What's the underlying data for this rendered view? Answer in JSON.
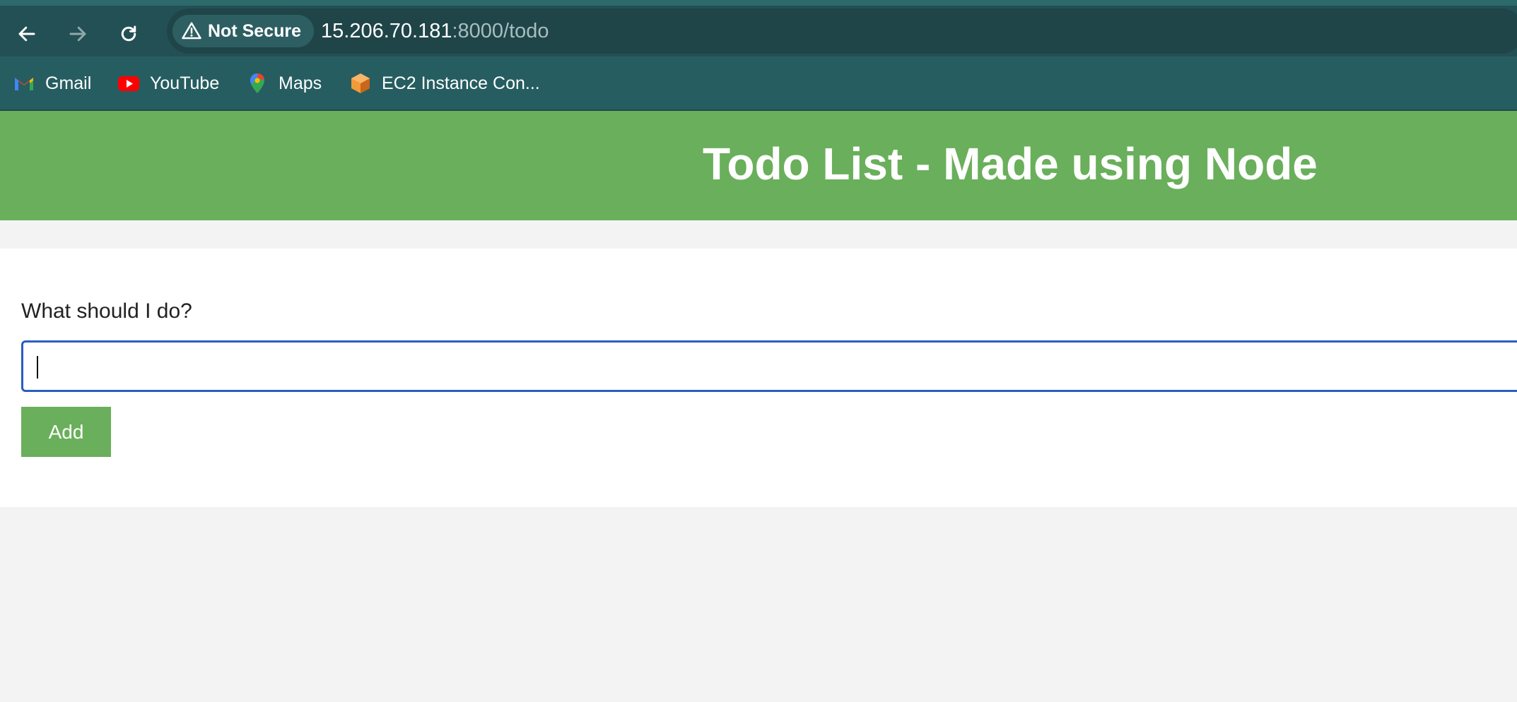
{
  "browser": {
    "security_label": "Not Secure",
    "url_host": "15.206.70.181",
    "url_path": ":8000/todo",
    "icons": {
      "back": "arrow-left-icon",
      "forward": "arrow-right-icon",
      "reload": "reload-icon",
      "security": "warning-triangle-icon"
    }
  },
  "bookmarks": [
    {
      "label": "Gmail",
      "icon": "gmail-icon"
    },
    {
      "label": "YouTube",
      "icon": "youtube-icon"
    },
    {
      "label": "Maps",
      "icon": "maps-icon"
    },
    {
      "label": "EC2 Instance Con...",
      "icon": "ec2-icon"
    }
  ],
  "page": {
    "title": "Todo List - Made using Node",
    "form": {
      "label": "What should I do?",
      "input_value": "",
      "button_label": "Add"
    }
  },
  "colors": {
    "toolbar": "#235054",
    "bookmarks_bar": "#265d61",
    "header_green": "#6aaf5b",
    "input_focus_border": "#2a5dbf",
    "page_background": "#f3f3f3"
  }
}
